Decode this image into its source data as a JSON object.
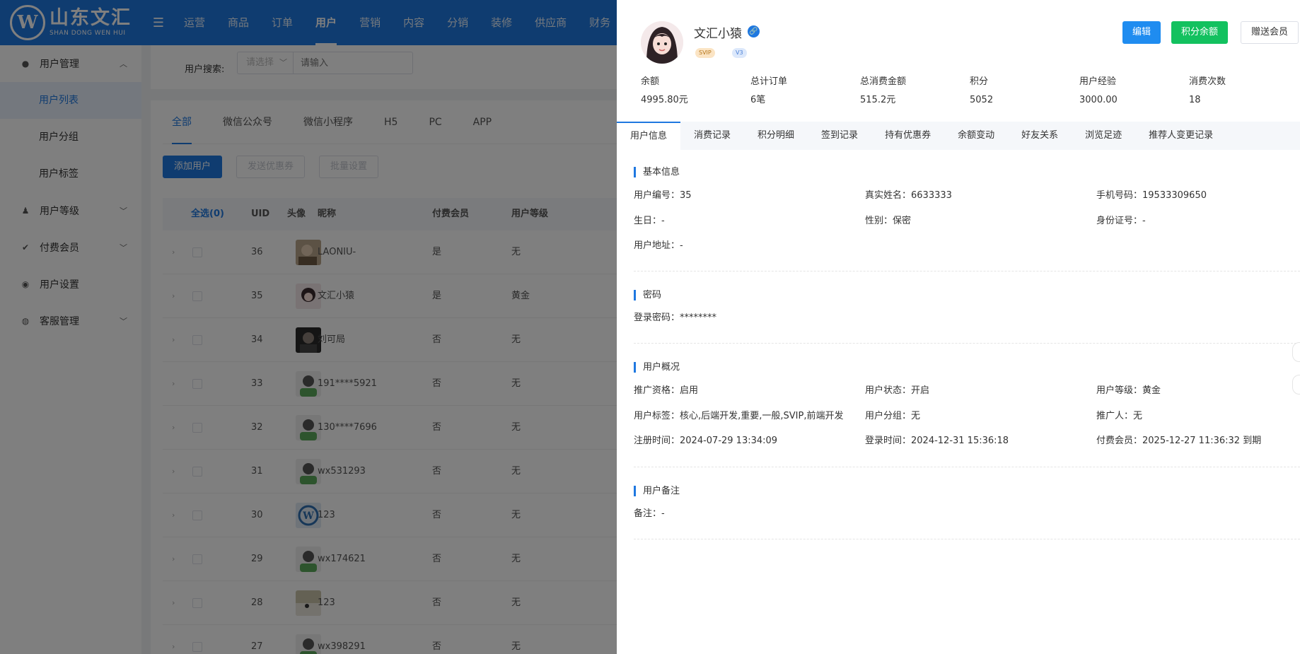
{
  "app": {
    "logo_cn": "山东文汇",
    "logo_en": "SHAN DONG WEN HUI",
    "logo_mark": "W",
    "nav": [
      "运营",
      "商品",
      "订单",
      "用户",
      "营销",
      "内容",
      "分销",
      "装修",
      "供应商",
      "财务"
    ]
  },
  "sidebar": {
    "groups": [
      {
        "label": "用户管理",
        "icon": "user-icon"
      },
      {
        "label": "用户等级",
        "icon": "user-level-icon"
      },
      {
        "label": "付费会员",
        "icon": "vip-icon"
      },
      {
        "label": "用户设置",
        "icon": "palette-icon"
      },
      {
        "label": "客服管理",
        "icon": "chat-icon"
      }
    ],
    "subitems": [
      "用户列表",
      "用户分组",
      "用户标签"
    ]
  },
  "search": {
    "label": "用户搜索:",
    "select_placeholder": "请选择",
    "input_placeholder": "请输入"
  },
  "list": {
    "tabs": [
      "全部",
      "微信公众号",
      "微信小程序",
      "H5",
      "PC",
      "APP"
    ],
    "buttons": [
      "添加用户",
      "发送优惠券",
      "批量设置"
    ],
    "headers": {
      "select": "全选(0)",
      "uid": "UID",
      "avatar": "头像",
      "nickname": "昵称",
      "paid": "付费会员",
      "level": "用户等级"
    },
    "rows": [
      {
        "uid": "36",
        "nickname": "LAONIU-",
        "paid": "是",
        "level": "无"
      },
      {
        "uid": "35",
        "nickname": "文汇小猿",
        "paid": "是",
        "level": "黄金"
      },
      {
        "uid": "34",
        "nickname": "刘可局",
        "paid": "否",
        "level": "无"
      },
      {
        "uid": "33",
        "nickname": "191****5921",
        "paid": "否",
        "level": "无"
      },
      {
        "uid": "32",
        "nickname": "130****7696",
        "paid": "否",
        "level": "无"
      },
      {
        "uid": "31",
        "nickname": "wx531293",
        "paid": "否",
        "level": "无"
      },
      {
        "uid": "30",
        "nickname": "123",
        "paid": "否",
        "level": "无"
      },
      {
        "uid": "29",
        "nickname": "wx174621",
        "paid": "否",
        "level": "无"
      },
      {
        "uid": "28",
        "nickname": "123",
        "paid": "否",
        "level": "无"
      },
      {
        "uid": "27",
        "nickname": "wx398291",
        "paid": "否",
        "level": "无"
      }
    ]
  },
  "drawer": {
    "name": "文汇小猿",
    "badges": [
      "SVIP",
      "V3"
    ],
    "buttons": {
      "edit": "编辑",
      "points": "积分余额",
      "gift": "赠送会员"
    },
    "stats": [
      {
        "label": "余额",
        "value": "4995.80元"
      },
      {
        "label": "总计订单",
        "value": "6笔"
      },
      {
        "label": "总消费金额",
        "value": "515.2元"
      },
      {
        "label": "积分",
        "value": "5052"
      },
      {
        "label": "用户经验",
        "value": "3000.00"
      },
      {
        "label": "消费次数",
        "value": "18"
      }
    ],
    "tabs": [
      "用户信息",
      "消费记录",
      "积分明细",
      "签到记录",
      "持有优惠券",
      "余额变动",
      "好友关系",
      "浏览足迹",
      "推荐人变更记录"
    ],
    "sections": {
      "basic": {
        "title": "基本信息",
        "items": [
          "用户编号：35",
          "真实姓名：6633333",
          "手机号码：19533309650",
          "生日：-",
          "性别：保密",
          "身份证号：-",
          "用户地址：-"
        ]
      },
      "password": {
        "title": "密码",
        "items": [
          "登录密码：********"
        ]
      },
      "overview": {
        "title": "用户概况",
        "items": [
          "推广资格：启用",
          "用户状态：开启",
          "用户等级：黄金",
          "用户标签：核心,后端开发,重要,一般,SVIP,前端开发",
          "用户分组：无",
          "推广人：无",
          "注册时间：2024-07-29 13:34:09",
          "登录时间：2024-12-31 15:36:18",
          "付费会员：2025-12-27 11:36:32 到期"
        ]
      },
      "note": {
        "title": "用户备注",
        "items": [
          "备注：-"
        ]
      }
    }
  },
  "colors": {
    "primary": "#1f78e0",
    "success": "#13c15f",
    "overlay": "rgba(0,0,0,0.5)"
  }
}
